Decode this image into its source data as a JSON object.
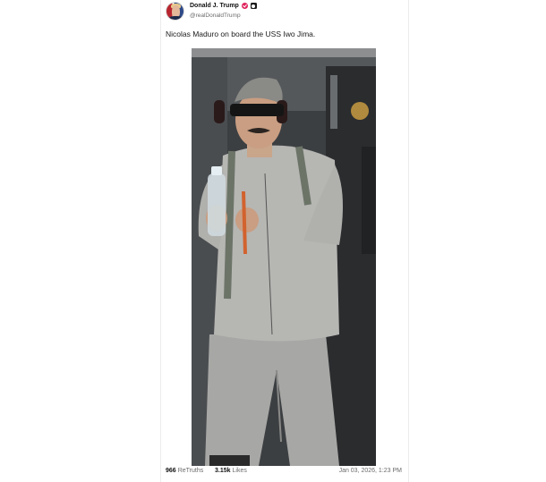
{
  "post": {
    "author": {
      "display_name": "Donald J. Trump",
      "handle": "@realDonaldTrump",
      "avatar_icon": "user-avatar",
      "verified_icon": "verified-check-icon",
      "badge_icon": "account-badge-icon",
      "verified_color": "#e0245e"
    },
    "text": "Nicolas Maduro on board the USS Iwo Jima.",
    "media": {
      "type": "photo"
    },
    "stats": {
      "retruths_count": "966",
      "retruths_label": "ReTruths",
      "likes_count": "3.15k",
      "likes_label": "Likes"
    },
    "timestamp": "Jan 03, 2026, 1:23 PM"
  }
}
